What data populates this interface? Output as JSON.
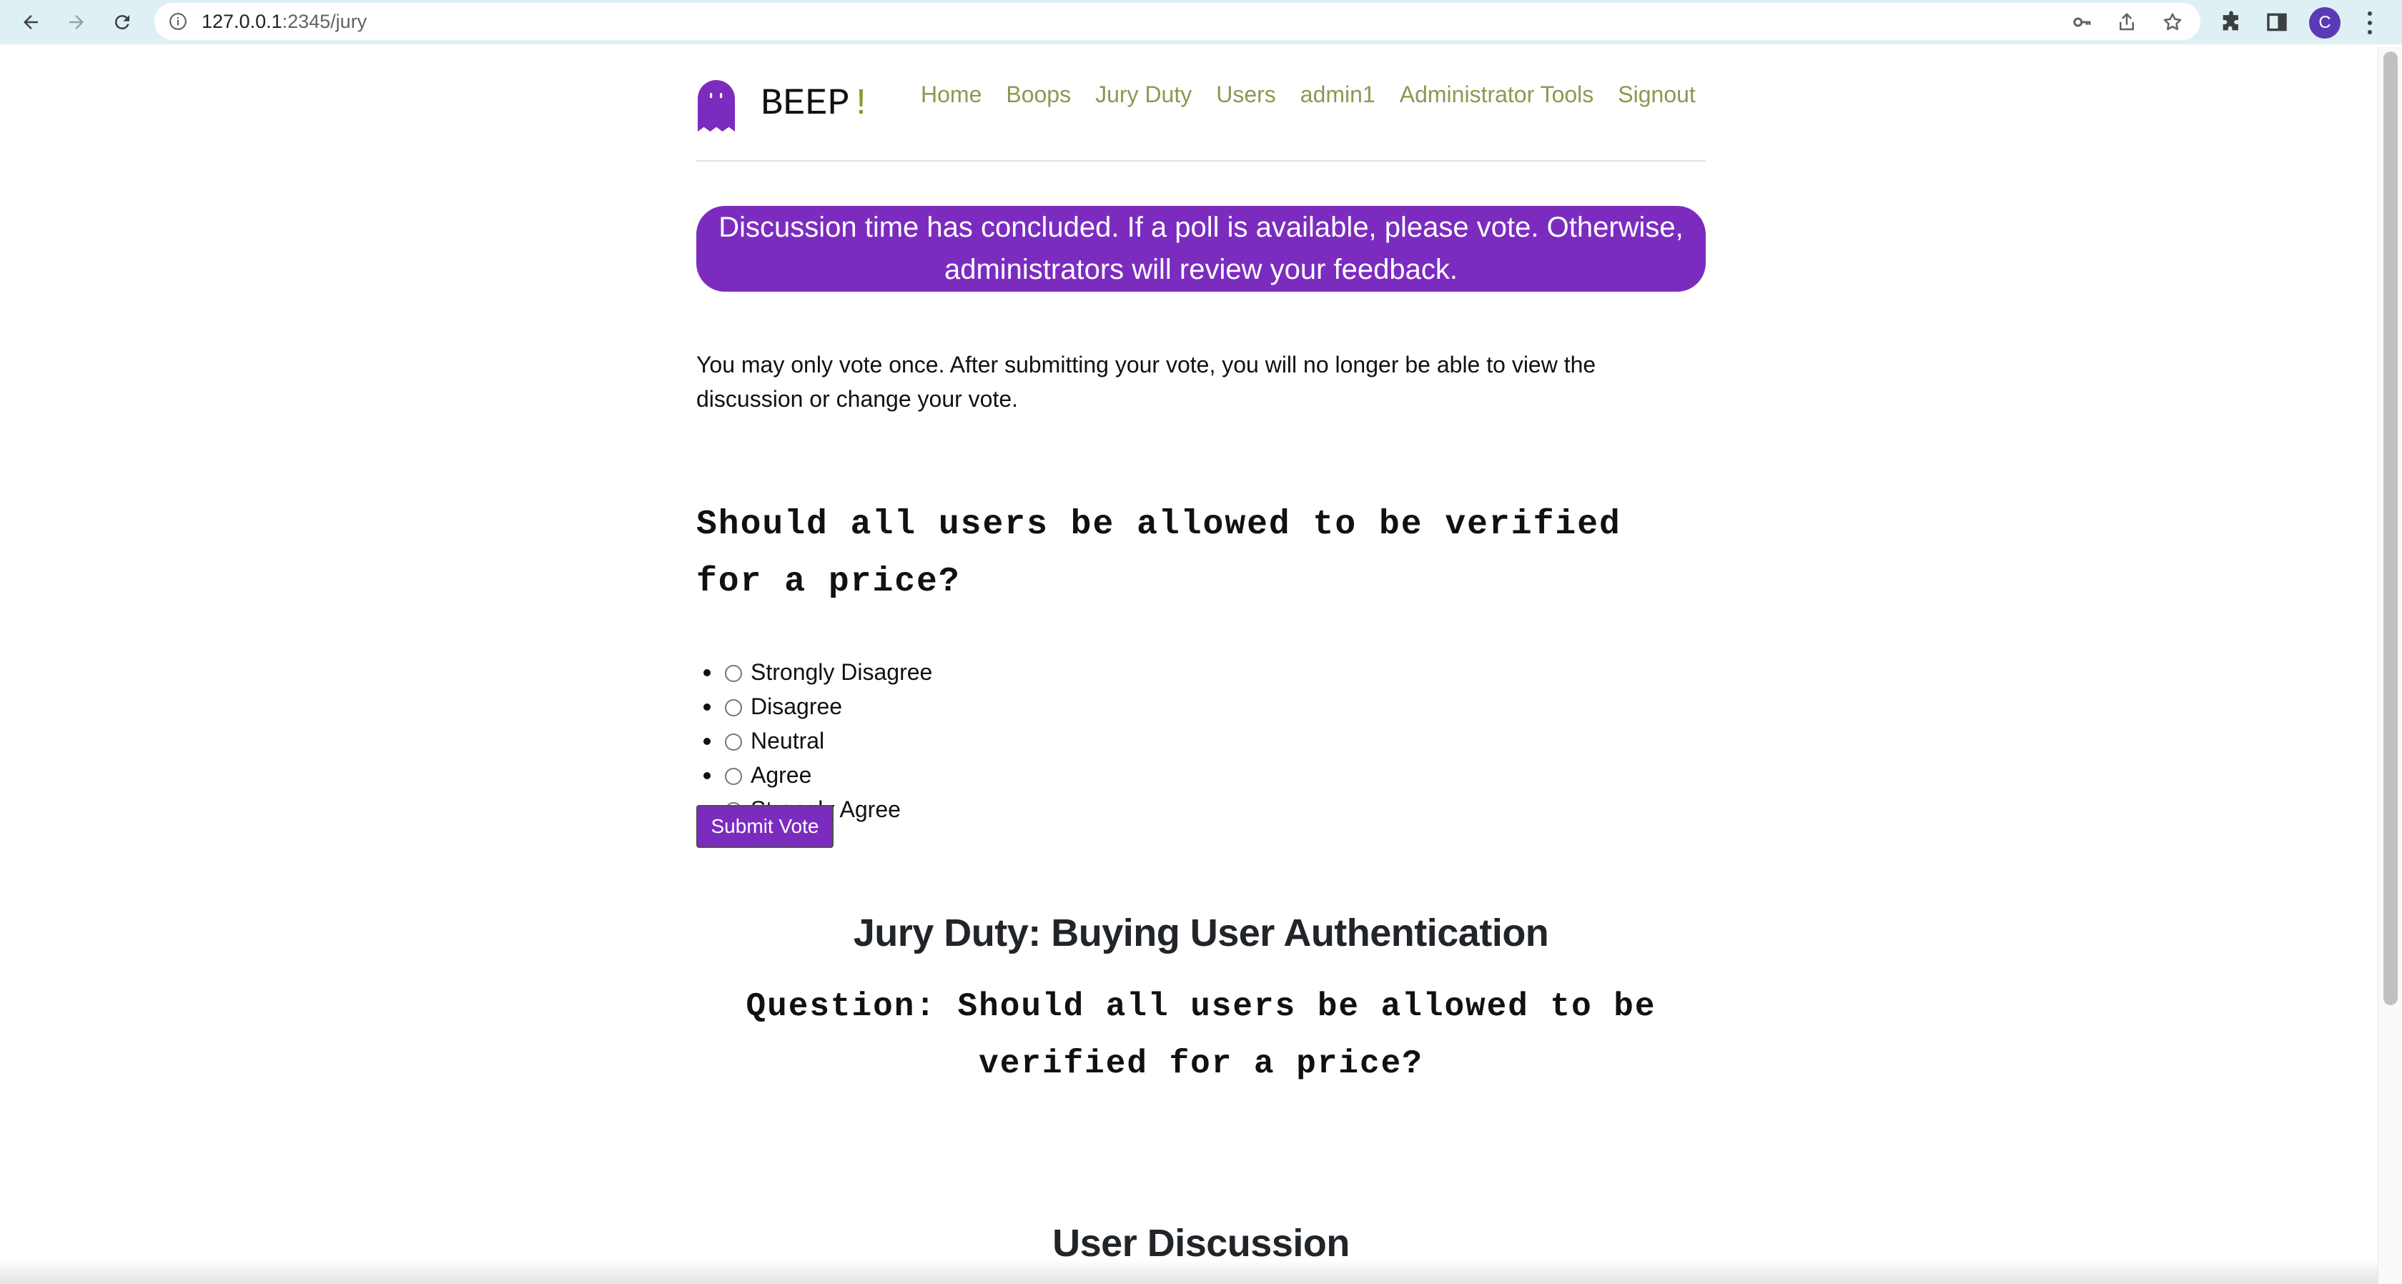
{
  "browser": {
    "url_host": "127.0.0.1",
    "url_rest": ":2345/jury",
    "avatar_letter": "C",
    "icons": [
      "back-icon",
      "forward-icon",
      "reload-icon",
      "info-icon",
      "key-icon",
      "share-icon",
      "star-icon",
      "puzzle-icon",
      "sidebar-icon",
      "kebab-menu-icon"
    ]
  },
  "brand": {
    "name": "BEEP",
    "bang": "!",
    "accent_color": "#7b2cbf"
  },
  "nav": {
    "items": [
      {
        "label": "Home"
      },
      {
        "label": "Boops"
      },
      {
        "label": "Jury Duty"
      },
      {
        "label": "Users"
      },
      {
        "label": "admin1"
      },
      {
        "label": "Administrator Tools"
      },
      {
        "label": "Signout"
      }
    ]
  },
  "alert": {
    "text": "Discussion time has concluded. If a poll is available, please vote. Otherwise, administrators will review your feedback."
  },
  "notice": {
    "text": "You may only vote once. After submitting your vote, you will no longer be able to view the discussion or change your vote."
  },
  "poll": {
    "question": "Should all users be allowed to be verified for a price?",
    "options": [
      {
        "label": "Strongly Disagree"
      },
      {
        "label": "Disagree"
      },
      {
        "label": "Neutral"
      },
      {
        "label": "Agree"
      },
      {
        "label": "Strongly Agree"
      }
    ],
    "submit_label": "Submit Vote"
  },
  "jury": {
    "title": "Jury Duty: Buying User Authentication",
    "question": "Question: Should all users be allowed to be verified for a price?"
  },
  "discussion": {
    "title": "User Discussion"
  }
}
